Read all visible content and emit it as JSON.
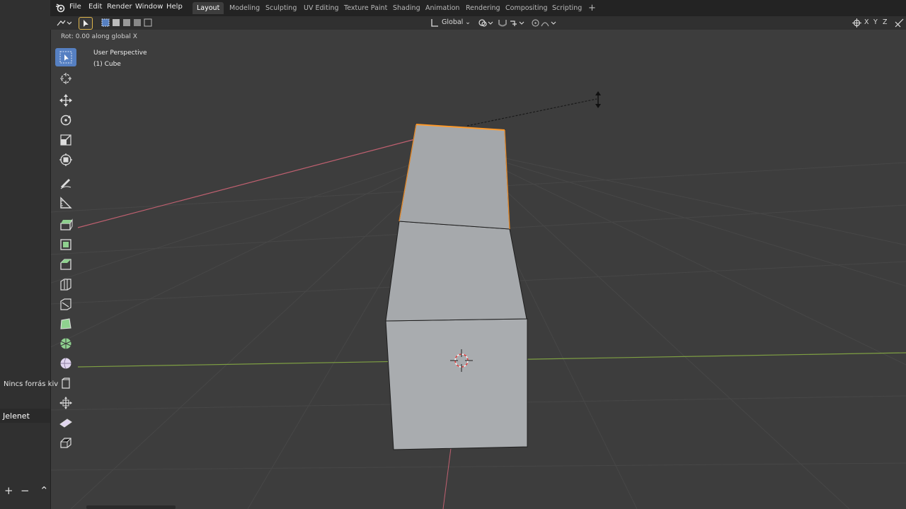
{
  "menu": {
    "items": [
      "File",
      "Edit",
      "Render",
      "Window",
      "Help"
    ]
  },
  "workspaces": {
    "tabs": [
      "Layout",
      "Modeling",
      "Sculpting",
      "UV Editing",
      "Texture Paint",
      "Shading",
      "Animation",
      "Rendering",
      "Compositing",
      "Scripting"
    ],
    "active": "Layout",
    "add_label": "+"
  },
  "header": {
    "orientation": "Global",
    "axis_x": "X",
    "axis_y": "Y",
    "axis_z": "Z"
  },
  "status": {
    "operation": "Rot: 0.00 along global X"
  },
  "viewport": {
    "view_name": "User Perspective",
    "object_name": "(1) Cube"
  },
  "left_panel": {
    "source_text": "Nincs forrás kiv",
    "scene_label": "Jelenet",
    "add_btn": "+",
    "remove_btn": "−",
    "up_btn": "⌃"
  },
  "toolbar": {
    "tools": [
      "select-box",
      "cursor",
      "move",
      "rotate",
      "scale",
      "transform",
      "annotate",
      "measure",
      "extrude-region",
      "inset-faces",
      "bevel",
      "loop-cut",
      "knife",
      "poly-build",
      "spin",
      "smooth",
      "edge-slide",
      "shrink-fatten",
      "shear",
      "rip-region"
    ],
    "active": "select-box"
  },
  "colors": {
    "background": "#3d3d3d",
    "grid": "#474747",
    "axis_x": "#c06070",
    "axis_y": "#7fa043",
    "mesh_face": "#a6a9ac",
    "selection": "#ff9a2a",
    "active_tool": "#5680c2"
  }
}
